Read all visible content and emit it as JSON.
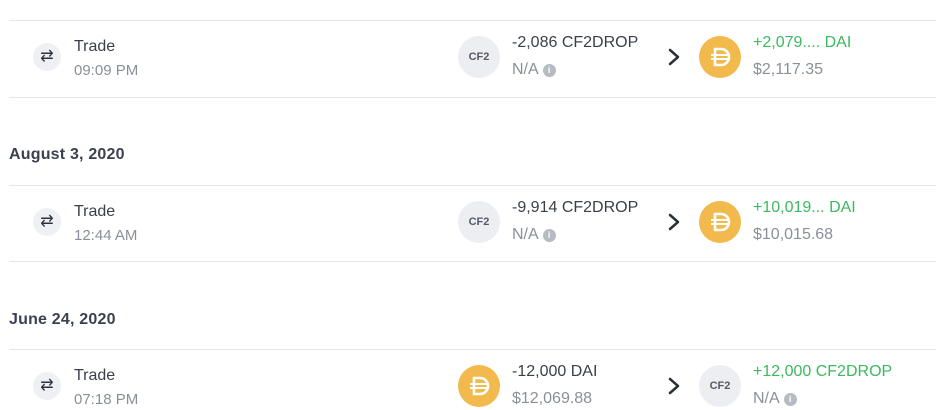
{
  "icons": {
    "trade": "⇄",
    "info": "i",
    "chevron": "chevron-right-icon",
    "dai": "dai-logo-icon"
  },
  "colors": {
    "dai": "#f2b94c",
    "positive": "#3cb95e",
    "muted": "#8a8f99"
  },
  "groups": [
    {
      "date": "",
      "tx": {
        "type": "Trade",
        "time": "09:09 PM",
        "sent": {
          "icon": "CF2",
          "amount": "-2,086 CF2DROP",
          "value": "N/A"
        },
        "received": {
          "icon": "DAI",
          "amount": "+2,079....  DAI",
          "value": "$2,117.35"
        }
      }
    },
    {
      "date": "August 3, 2020",
      "tx": {
        "type": "Trade",
        "time": "12:44 AM",
        "sent": {
          "icon": "CF2",
          "amount": "-9,914 CF2DROP",
          "value": "N/A"
        },
        "received": {
          "icon": "DAI",
          "amount": "+10,019...  DAI",
          "value": "$10,015.68"
        }
      }
    },
    {
      "date": "June 24, 2020",
      "tx": {
        "type": "Trade",
        "time": "07:18 PM",
        "sent": {
          "icon": "DAI",
          "amount": "-12,000 DAI",
          "value": "$12,069.88"
        },
        "received": {
          "icon": "CF2",
          "amount": "+12,000 CF2DROP",
          "value": "N/A"
        }
      }
    }
  ]
}
